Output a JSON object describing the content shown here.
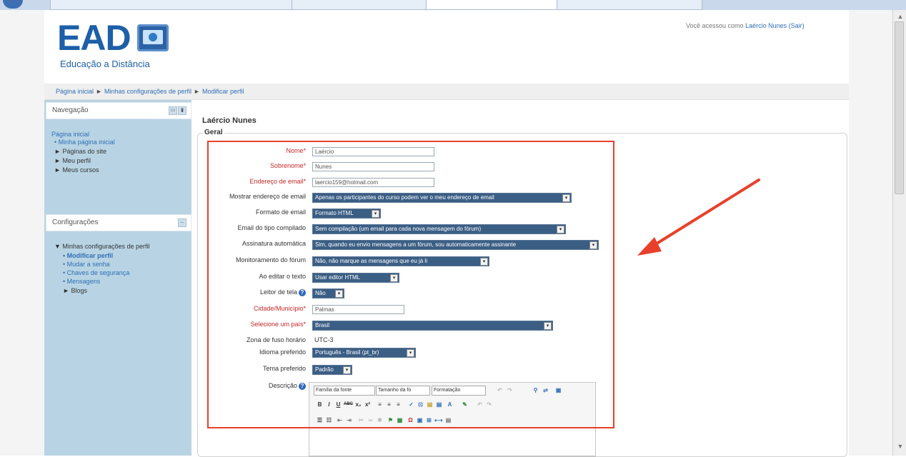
{
  "browser": {
    "tabs": [
      "",
      "",
      "",
      ""
    ]
  },
  "header": {
    "logo_text": "EAD",
    "logo_subtitle": "Educação a Distância",
    "login_prefix": "Você acessou como",
    "login_user": "Laércio Nunes",
    "logout": "(Sair)"
  },
  "breadcrumb": {
    "items": [
      "Página inicial",
      "Minhas configurações de perfil",
      "Modificar perfil"
    ],
    "separator": "►"
  },
  "navigation": {
    "title": "Navegação",
    "home": "Página inicial",
    "items": [
      {
        "marker": "•",
        "label": "Minha página inicial"
      },
      {
        "marker": "►",
        "label": "Páginas do site"
      },
      {
        "marker": "►",
        "label": "Meu perfil"
      },
      {
        "marker": "►",
        "label": "Meus cursos"
      }
    ]
  },
  "settings": {
    "title": "Configurações",
    "group": "Minhas configurações de perfil",
    "items": [
      {
        "marker": "•",
        "label": "Modificar perfil"
      },
      {
        "marker": "•",
        "label": "Mudar a senha"
      },
      {
        "marker": "•",
        "label": "Chaves de segurança"
      },
      {
        "marker": "•",
        "label": "Mensagens"
      },
      {
        "marker": "►",
        "label": "Blogs"
      }
    ]
  },
  "main": {
    "title": "Laércio Nunes",
    "section": "Geral"
  },
  "form": {
    "nome": {
      "label": "Nome",
      "value": "Laércio"
    },
    "sobrenome": {
      "label": "Sobrenome",
      "value": "Nunes"
    },
    "email": {
      "label": "Endereço de email",
      "value": "laercio159@hotmail.com"
    },
    "mostrar_email": {
      "label": "Mostrar endereço de email",
      "value": "Apenas os participantes do curso podem ver o meu endereço de email"
    },
    "formato_email": {
      "label": "Formato de email",
      "value": "Formato HTML"
    },
    "email_compilado": {
      "label": "Email do tipo compilado",
      "value": "Sem compilação (um email para cada nova mensagem do fórum)"
    },
    "assinatura": {
      "label": "Assinatura automática",
      "value": "Sim, quando eu envio mensagens a um fórum, sou automaticamente assinante"
    },
    "monitoramento": {
      "label": "Monitoramento do fórum",
      "value": "Não, não marque as mensagens que eu já li"
    },
    "editar_texto": {
      "label": "Ao editar o texto",
      "value": "Usar editor HTML"
    },
    "leitor_tela": {
      "label": "Leitor de tela",
      "value": "Não"
    },
    "cidade": {
      "label": "Cidade/Município",
      "value": "Palmas"
    },
    "pais": {
      "label": "Selecione um país",
      "value": "Brasil"
    },
    "fuso": {
      "label": "Zona de fuso horário",
      "value": "UTC-3"
    },
    "idioma": {
      "label": "Idioma preferido",
      "value": "Português - Brasil (pt_br)"
    },
    "tema": {
      "label": "Tema preferido",
      "value": "Padrão"
    },
    "descricao": {
      "label": "Descrição"
    }
  },
  "editor": {
    "font_family": "Família da fonte",
    "font_size": "Tamanho da fo",
    "format": "Formatação",
    "row2": [
      "B",
      "I",
      "U",
      "ABC",
      "x₂",
      "x²",
      "≡",
      "≡",
      "≡",
      "✓",
      "⊡",
      "▤",
      "▤",
      "A",
      "✎",
      "↶",
      "↷"
    ],
    "row3": [
      "☰",
      "☷",
      "⇤",
      "⇥",
      "✂",
      "∞",
      "✱",
      "⚑",
      "▦",
      "Ω",
      "▣",
      "⊞",
      "⟷",
      "▤"
    ]
  },
  "colors": {
    "accent": "#1d5fa8",
    "link": "#2f6eb5",
    "sidebar_bg": "#b8d4e4",
    "select_bg": "#3b5e84",
    "required": "#c62828",
    "annotation": "#e8402a"
  }
}
